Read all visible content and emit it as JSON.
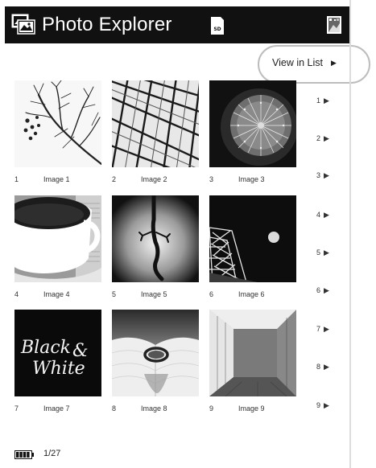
{
  "header": {
    "title": "Photo Explorer",
    "app_icon": "photo-explorer-icon",
    "sd_icon": "sd-card-icon",
    "right_icon": "image-icon"
  },
  "view_list": {
    "label": "View in List",
    "arrow": "▶"
  },
  "images": [
    {
      "number": "1",
      "label": "Image 1",
      "subject": "bare branches"
    },
    {
      "number": "2",
      "label": "Image 2",
      "subject": "glass roof"
    },
    {
      "number": "3",
      "label": "Image 3",
      "subject": "cactus"
    },
    {
      "number": "4",
      "label": "Image 4",
      "subject": "coffee cup"
    },
    {
      "number": "5",
      "label": "Image 5",
      "subject": "lizard"
    },
    {
      "number": "6",
      "label": "Image 6",
      "subject": "eiffel tower"
    },
    {
      "number": "7",
      "label": "Image 7",
      "subject": "black and white"
    },
    {
      "number": "8",
      "label": "Image 8",
      "subject": "ring on book"
    },
    {
      "number": "9",
      "label": "Image 9",
      "subject": "cube"
    }
  ],
  "image7_text": {
    "line1": "Black",
    "amp": "&",
    "line2": "White"
  },
  "pages": [
    {
      "label": "1",
      "arrow": "▶"
    },
    {
      "label": "2",
      "arrow": "▶"
    },
    {
      "label": "3",
      "arrow": "▶"
    },
    {
      "label": "4",
      "arrow": "▶"
    },
    {
      "label": "5",
      "arrow": "▶"
    },
    {
      "label": "6",
      "arrow": "▶"
    },
    {
      "label": "7",
      "arrow": "▶"
    },
    {
      "label": "8",
      "arrow": "▶"
    },
    {
      "label": "9",
      "arrow": "▶"
    }
  ],
  "footer": {
    "page_count": "1/27",
    "battery_icon": "battery-icon"
  },
  "colors": {
    "titlebar": "#111111",
    "oval": "#bdbdbd",
    "text": "#222222"
  }
}
